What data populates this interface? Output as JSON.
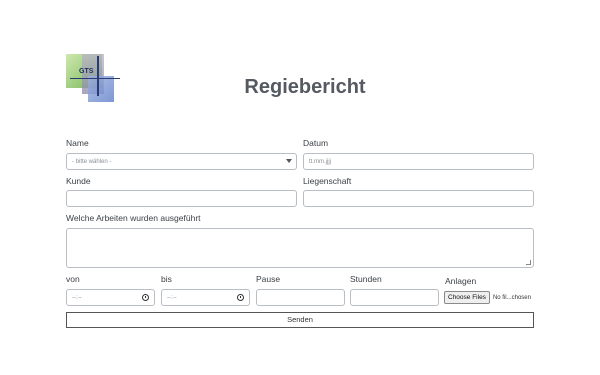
{
  "logo": {
    "text": "GTS"
  },
  "title": "Regiebericht",
  "form": {
    "name": {
      "label": "Name",
      "value": "- bitte wählen -"
    },
    "datum": {
      "label": "Datum",
      "placeholder": "tt.mm.jjjj"
    },
    "kunde": {
      "label": "Kunde",
      "value": ""
    },
    "liegenschaft": {
      "label": "Liegenschaft",
      "value": ""
    },
    "arbeiten": {
      "label": "Welche Arbeiten wurden ausgeführt",
      "value": ""
    },
    "von": {
      "label": "von",
      "placeholder": "--:--"
    },
    "bis": {
      "label": "bis",
      "placeholder": "--:--"
    },
    "pause": {
      "label": "Pause",
      "value": ""
    },
    "stunden": {
      "label": "Stunden",
      "value": ""
    },
    "anlagen": {
      "label": "Anlagen",
      "button": "Choose Files",
      "status": "No fil...chosen"
    },
    "submit": "Senden"
  }
}
